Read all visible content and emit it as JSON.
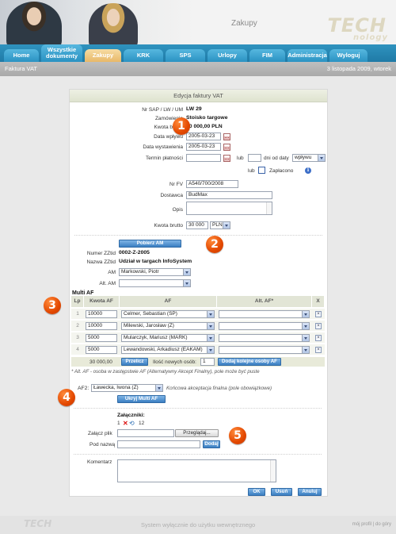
{
  "header": {
    "title": "Zakupy",
    "logo_main": "TECH",
    "logo_sub": "nology"
  },
  "nav": {
    "tabs": [
      {
        "label": "Home"
      },
      {
        "label": "Wszystkie dokumenty"
      },
      {
        "label": "Zakupy",
        "active": true
      },
      {
        "label": "KRK"
      },
      {
        "label": "SPS"
      },
      {
        "label": "Urlopy"
      },
      {
        "label": "FIM"
      },
      {
        "label": "Administracja"
      },
      {
        "label": "Wyloguj"
      }
    ]
  },
  "subbar": {
    "left": "Faktura VAT",
    "right": "3 listopada 2009, wtorek"
  },
  "panel": {
    "title": "Edycja faktury VAT"
  },
  "doc": {
    "nr_sap_label": "Nr SAP / LW / UM",
    "nr_sap_value": "LW 29",
    "zamowienie_label": "Zamówienie",
    "zamowienie_value": "Stoisko targowe",
    "kwota_brutto_label": "Kwota brutto",
    "kwota_brutto_value": "30 000,00 PLN",
    "data_wplywu_label": "Data wpływu",
    "data_wplywu_value": "2005-03-23",
    "data_wystawienia_label": "Data wystawienia",
    "data_wystawienia_value": "2005-03-23",
    "termin_label": "Termin płatności",
    "lub1": "lub",
    "dni_od_daty": "dni od daty",
    "termin_select": "wpływu",
    "lub2": "lub",
    "zaplacono_label": "Zapłacono",
    "nr_fv_label": "Nr FV",
    "nr_fv_value": "A540/700/2008",
    "dostawca_label": "Dostawca",
    "dostawca_value": "BudMax",
    "opis_label": "Opis",
    "kwota_brutto2_label": "Kwota brutto",
    "kwota_brutto2_value": "30 000",
    "currency": "PLN"
  },
  "am": {
    "pobierz_button": "Pobierz AM",
    "numer_zztid_label": "Numer ZZtid",
    "numer_zztid_value": "0002-Z-2005",
    "nazwa_zztid_label": "Nazwa ZZtid",
    "nazwa_zztid_value": "Udział w targach InfoSystem",
    "am_label": "AM",
    "am_value": "Markowski, Piotr",
    "alt_am_label": "Alt. AM"
  },
  "multi_af": {
    "title": "Multi AF",
    "headers": {
      "lp": "Lp",
      "kwota": "Kwota AF",
      "af": "AF",
      "alt_af": "Alt. AF*",
      "x": "X"
    },
    "rows": [
      {
        "lp": "1",
        "kwota": "10000",
        "af": "Celmer, Sebastian (SP)"
      },
      {
        "lp": "2",
        "kwota": "10000",
        "af": "Milewski, Jarosław (Z)"
      },
      {
        "lp": "3",
        "kwota": "5000",
        "af": "Mularczyk, Mariusz (MARK)"
      },
      {
        "lp": "4",
        "kwota": "5000",
        "af": "Lewandowski, Arkadiusz (EAKAM)"
      }
    ],
    "total": "30 000,00",
    "przelicz_button": "Przelicz",
    "ilosc_label": "Ilość nowych osób:",
    "ilosc_value": "1",
    "dodaj_button": "Dodaj kolejne osoby AF",
    "note": "* Alt. AF - osoba w zastępstwie AF (Alternatywny Akcept Finalny), pole może być puste"
  },
  "af2": {
    "label": "AF2:",
    "value": "Ławecka, Iwona (Z)",
    "note": "Końcowa akceptacja finalna (pole obowiązkowe)",
    "ukryj_button": "Ukryj Multi AF"
  },
  "zalaczniki": {
    "title": "Załączniki:",
    "line_a": "1",
    "line_b": "12",
    "zalacz_label": "Załącz plik",
    "przegladaj_button": "Przeglądaj...",
    "pod_nazwa_label": "Pod nazwą",
    "dodaj_button": "Dodaj"
  },
  "komentarz": {
    "label": "Komentarz"
  },
  "actions": {
    "ok": "OK",
    "usun": "Usuń",
    "anuluj": "Anuluj"
  },
  "badges": [
    "1",
    "2",
    "3",
    "4",
    "5"
  ],
  "footer": {
    "logo": "TECH",
    "text": "System wyłącznie do użytku wewnętrznego",
    "links": "mój profil  |  do góry"
  },
  "colors": {
    "nav_blue": "#2a92c2",
    "active_tab": "#e8b868",
    "badge_orange": "#e34800",
    "button_blue": "#3b7fc2"
  }
}
